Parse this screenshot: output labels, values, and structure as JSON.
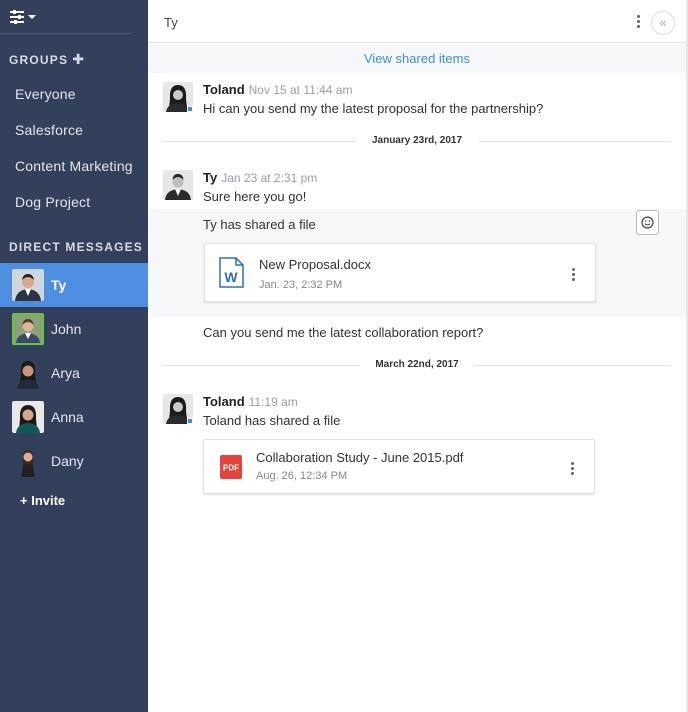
{
  "sidebar": {
    "groups_heading": "GROUPS",
    "groups_add": "✚",
    "groups": [
      "Everyone",
      "Salesforce",
      "Content Marketing",
      "Dog Project"
    ],
    "dm_heading": "DIRECT MESSAGES",
    "direct_messages": [
      {
        "name": "Ty",
        "active": true
      },
      {
        "name": "John",
        "active": false
      },
      {
        "name": "Arya",
        "active": false
      },
      {
        "name": "Anna",
        "active": false
      },
      {
        "name": "Dany",
        "active": false
      }
    ],
    "invite_label": "+ Invite"
  },
  "header": {
    "title": "Ty",
    "collapse_icon": "«"
  },
  "shared_items_link": "View shared items",
  "messages": [
    {
      "author": "Toland",
      "time": "Nov 15 at 11:44 am",
      "text": "Hi can you send my the latest proposal for the partnership?"
    },
    {
      "author": "Ty",
      "time": "Jan 23 at 2:31 pm",
      "text": "Sure here you go!",
      "shared_note": "Ty has shared a file",
      "followup": "Can you send me the latest collaboration report?"
    },
    {
      "author": "Toland",
      "time": "11:19 am",
      "text": "Toland has shared a file"
    }
  ],
  "date_separators": [
    "January 23rd, 2017",
    "March 22nd, 2017"
  ],
  "files": [
    {
      "name": "New Proposal.docx",
      "date": "Jan. 23, 2:32 PM",
      "icon_label": "W"
    },
    {
      "name": "Collaboration Study - June 2015.pdf",
      "date": "Aug. 26, 12:34 PM",
      "icon_label": "PDF"
    }
  ],
  "colors": {
    "sidebar_bg": "#33405c",
    "active_item": "#4d8ee0",
    "link": "#3f8ed6",
    "pdf_red": "#e2453c"
  }
}
